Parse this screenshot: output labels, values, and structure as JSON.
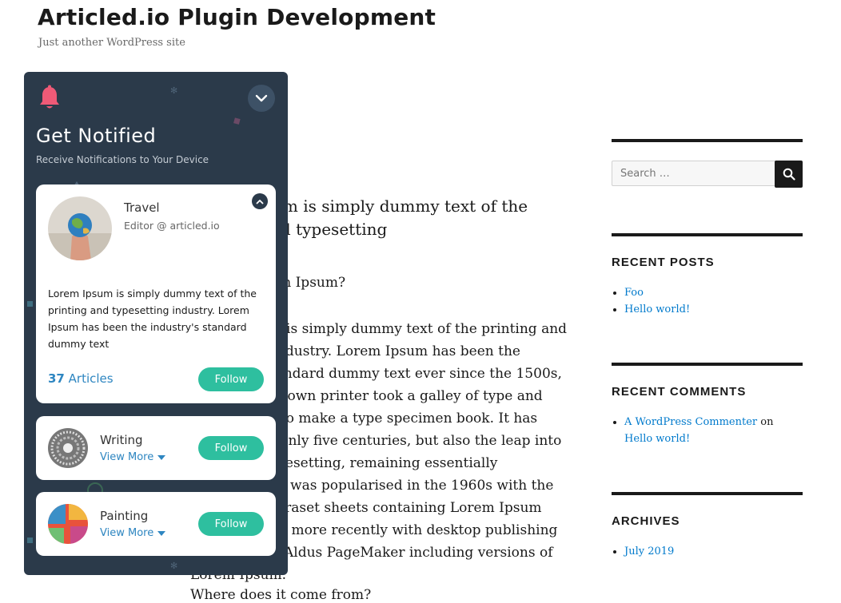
{
  "site": {
    "title": "Articled.io Plugin Development",
    "tagline": "Just another WordPress site"
  },
  "content": {
    "heading": "Lorem Ipsum is simply dummy text of the printing and typesetting",
    "question1": "What is Lorem Ipsum?",
    "body": "Lorem Ipsum is simply dummy text of the printing and typesetting industry. Lorem Ipsum has been the industry’s standard dummy text ever since the 1500s, when an unknown printer took a galley of type and scrambled it to make a type specimen book. It has survived not only five centuries, but also the leap into electronic typesetting, remaining essentially unchanged. It was popularised in the 1960s with the release of Letraset sheets containing Lorem Ipsum passages, and more recently with desktop publishing software like Aldus PageMaker including versions of Lorem Ipsum.",
    "question2": "Where does it come from?"
  },
  "sidebar": {
    "search_placeholder": "Search …",
    "recent_posts": {
      "title": "RECENT POSTS",
      "items": [
        "Foo",
        "Hello world!"
      ]
    },
    "recent_comments": {
      "title": "RECENT COMMENTS",
      "author": "A WordPress Commenter",
      "on": "on",
      "post": "Hello world!"
    },
    "archives": {
      "title": "ARCHIVES",
      "items": [
        "July 2019"
      ]
    }
  },
  "panel": {
    "title": "Get Notified",
    "subtitle": "Receive Notifications to Your Device",
    "main_card": {
      "name": "Travel",
      "role": "Editor @ articled.io",
      "description": "Lorem Ipsum is simply dummy text of the printing and typesetting industry. Lorem Ipsum has been the industry's standard dummy text",
      "articles_count": "37",
      "articles_label": "Articles",
      "follow_label": "Follow"
    },
    "small_cards": [
      {
        "name": "Writing",
        "more_label": "View More",
        "follow_label": "Follow"
      },
      {
        "name": "Painting",
        "more_label": "View More",
        "follow_label": "Follow"
      }
    ]
  },
  "colors": {
    "panel_bg": "#2b3a4a",
    "follow_button": "#2ebf9f",
    "bell": "#ef5a77",
    "link": "#007acc"
  },
  "icons": [
    "bell-icon",
    "chevron-down-icon",
    "chevron-up-icon",
    "search-icon",
    "caret-down-icon"
  ]
}
